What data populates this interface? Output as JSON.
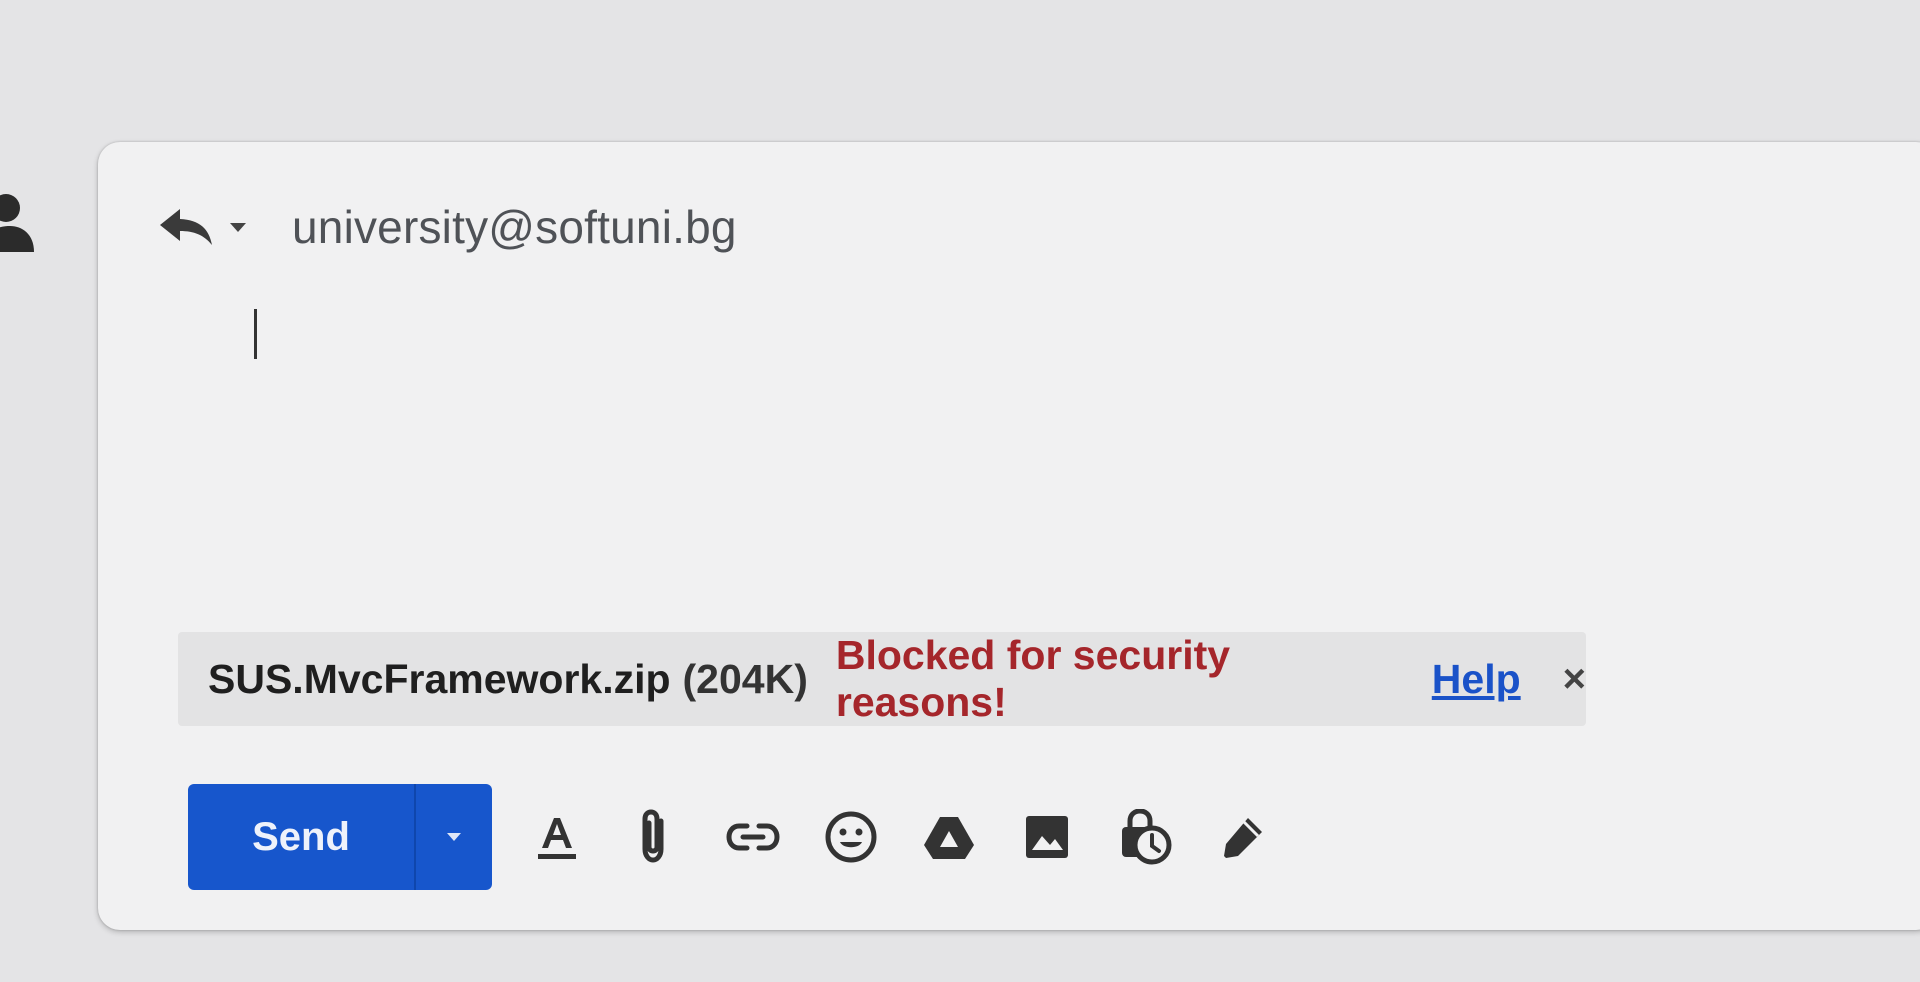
{
  "reply": {
    "recipient": "university@softuni.bg"
  },
  "attachment": {
    "filename": "SUS.MvcFramework.zip",
    "size": "(204K)",
    "status": "Blocked for security reasons!",
    "help_label": "Help",
    "close_label": "×"
  },
  "toolbar": {
    "send_label": "Send",
    "icons": [
      "format-text-icon",
      "attach-file-icon",
      "insert-link-icon",
      "emoji-icon",
      "drive-icon",
      "insert-photo-icon",
      "confidential-mode-icon",
      "signature-icon"
    ]
  },
  "colors": {
    "send": "#1756cc",
    "blocked": "#a5262b",
    "link": "#1a52c8"
  }
}
